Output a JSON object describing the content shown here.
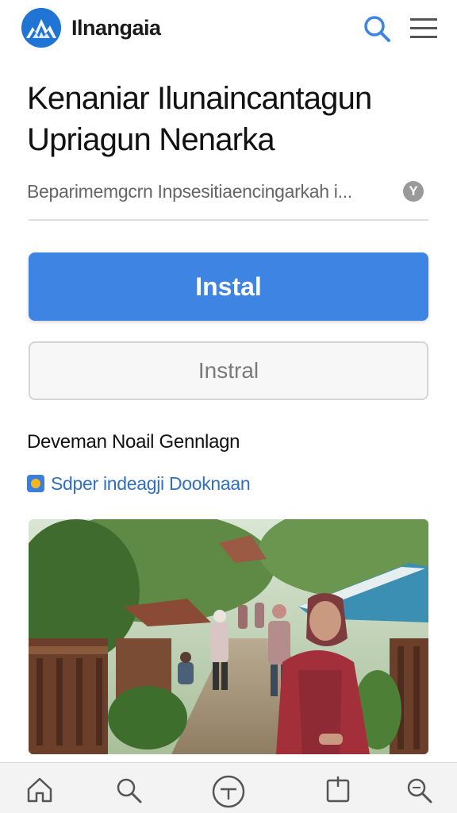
{
  "header": {
    "brand": "Ilnangaia",
    "logo_icon": "mountain-logo-icon",
    "search_icon": "search-icon",
    "menu_icon": "hamburger-menu-icon"
  },
  "main": {
    "title_line1": "Kenaniar Ilunaincantagun",
    "title_line2": "Upriagun Nenarka",
    "subtitle": "Beparimemgcrn Inpsesitiaencingarkah i...",
    "info_icon_glyph": "Y",
    "primary_button": "Instal",
    "secondary_button": "Instral",
    "section_title": "Deveman Noail Gennlagn",
    "source_link": "Sdper indeagji Dooknaan",
    "photo_alt": "village street with people"
  },
  "bottom_nav": {
    "items": [
      "home-icon",
      "search-icon",
      "add-circle-icon",
      "bookmark-icon",
      "zoom-search-icon"
    ]
  },
  "colors": {
    "accent": "#3d84e3",
    "brand": "#1f74d4",
    "link": "#2f6fc4"
  }
}
